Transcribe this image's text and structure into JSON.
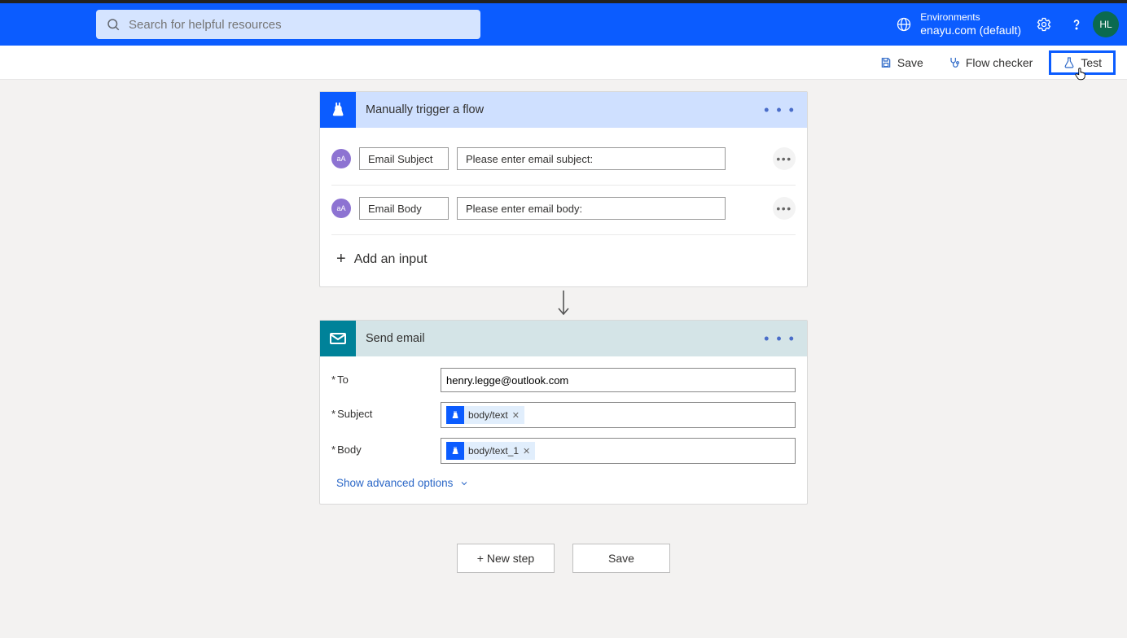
{
  "header": {
    "search_placeholder": "Search for helpful resources",
    "env_label": "Environments",
    "env_name": "enayu.com (default)",
    "avatar_initials": "HL"
  },
  "toolbar": {
    "save": "Save",
    "flow_checker": "Flow checker",
    "test": "Test"
  },
  "trigger_card": {
    "title": "Manually trigger a flow",
    "rows": [
      {
        "badge": "aA",
        "label": "Email Subject",
        "prompt": "Please enter email subject:"
      },
      {
        "badge": "aA",
        "label": "Email Body",
        "prompt": "Please enter email body:"
      }
    ],
    "add_input": "Add an input"
  },
  "send_card": {
    "title": "Send email",
    "to_label": "To",
    "to_value": "henry.legge@outlook.com",
    "subject_label": "Subject",
    "subject_token": "body/text",
    "body_label": "Body",
    "body_token": "body/text_1",
    "advanced": "Show advanced options"
  },
  "bottom": {
    "new_step": "+ New step",
    "save": "Save"
  }
}
